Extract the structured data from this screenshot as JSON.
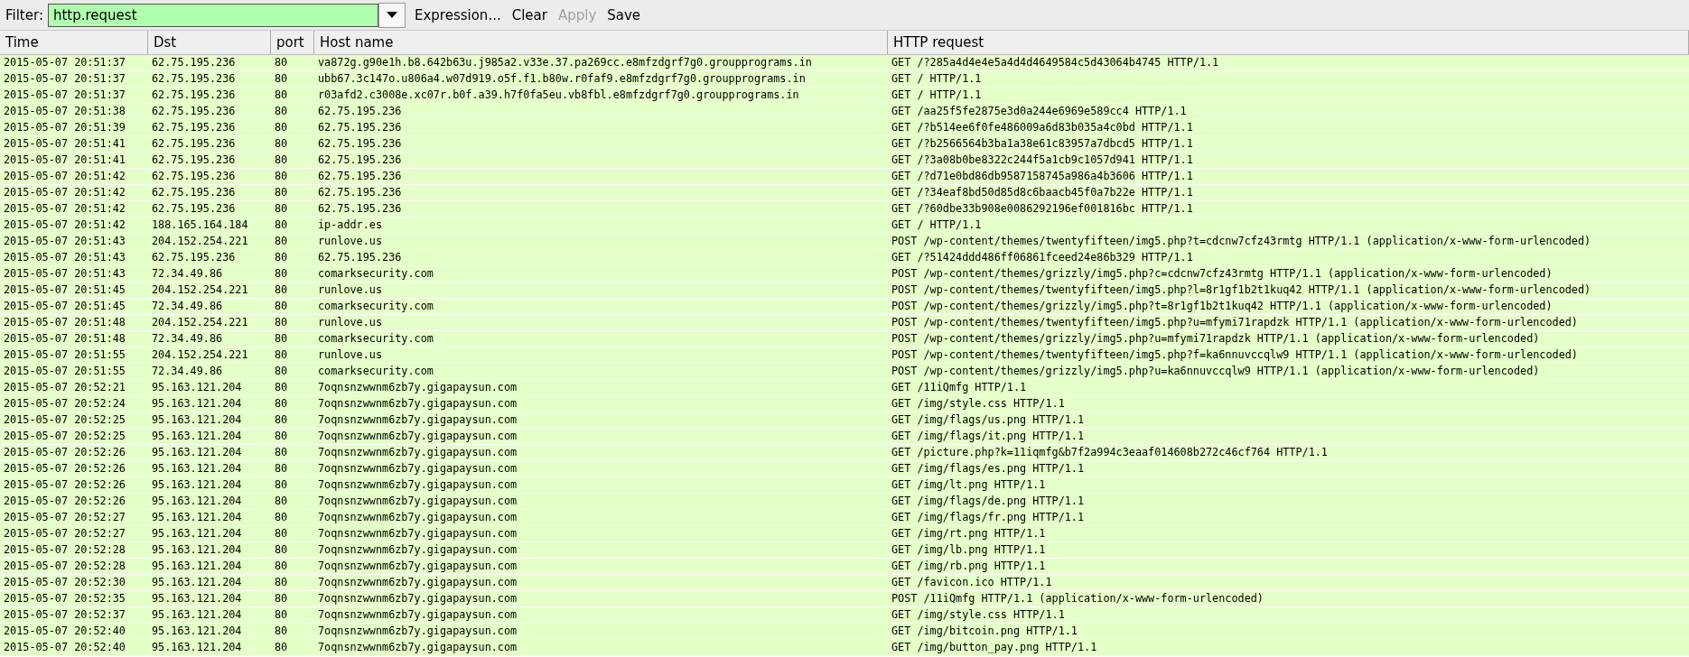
{
  "toolbar": {
    "filter_label": "Filter:",
    "filter_value": "http.request",
    "buttons": [
      {
        "label": "Expression...",
        "disabled": false
      },
      {
        "label": "Clear",
        "disabled": false
      },
      {
        "label": "Apply",
        "disabled": true
      },
      {
        "label": "Save",
        "disabled": false
      }
    ]
  },
  "table": {
    "columns": [
      "Time",
      "Dst",
      "port",
      "Host name",
      "HTTP request"
    ],
    "rows": [
      [
        "2015-05-07 20:51:37",
        "62.75.195.236",
        "80",
        "va872g.g90e1h.b8.642b63u.j985a2.v33e.37.pa269cc.e8mfzdgrf7g0.groupprograms.in",
        "GET /?285a4d4e4e5a4d4d4649584c5d43064b4745 HTTP/1.1"
      ],
      [
        "2015-05-07 20:51:37",
        "62.75.195.236",
        "80",
        "ubb67.3c147o.u806a4.w07d919.o5f.f1.b80w.r0faf9.e8mfzdgrf7g0.groupprograms.in",
        "GET / HTTP/1.1"
      ],
      [
        "2015-05-07 20:51:37",
        "62.75.195.236",
        "80",
        "r03afd2.c3008e.xc07r.b0f.a39.h7f0fa5eu.vb8fbl.e8mfzdgrf7g0.groupprograms.in",
        "GET / HTTP/1.1"
      ],
      [
        "2015-05-07 20:51:38",
        "62.75.195.236",
        "80",
        "62.75.195.236",
        "GET /aa25f5fe2875e3d0a244e6969e589cc4 HTTP/1.1"
      ],
      [
        "2015-05-07 20:51:39",
        "62.75.195.236",
        "80",
        "62.75.195.236",
        "GET /?b514ee6f0fe486009a6d83b035a4c0bd HTTP/1.1"
      ],
      [
        "2015-05-07 20:51:41",
        "62.75.195.236",
        "80",
        "62.75.195.236",
        "GET /?b2566564b3ba1a38e61c83957a7dbcd5 HTTP/1.1"
      ],
      [
        "2015-05-07 20:51:41",
        "62.75.195.236",
        "80",
        "62.75.195.236",
        "GET /?3a08b0be8322c244f5a1cb9c1057d941 HTTP/1.1"
      ],
      [
        "2015-05-07 20:51:42",
        "62.75.195.236",
        "80",
        "62.75.195.236",
        "GET /?d71e0bd86db9587158745a986a4b3606 HTTP/1.1"
      ],
      [
        "2015-05-07 20:51:42",
        "62.75.195.236",
        "80",
        "62.75.195.236",
        "GET /?34eaf8bd50d85d8c6baacb45f0a7b22e HTTP/1.1"
      ],
      [
        "2015-05-07 20:51:42",
        "62.75.195.236",
        "80",
        "62.75.195.236",
        "GET /?60dbe33b908e0086292196ef001816bc HTTP/1.1"
      ],
      [
        "2015-05-07 20:51:42",
        "188.165.164.184",
        "80",
        "ip-addr.es",
        "GET / HTTP/1.1"
      ],
      [
        "2015-05-07 20:51:43",
        "204.152.254.221",
        "80",
        "runlove.us",
        "POST /wp-content/themes/twentyfifteen/img5.php?t=cdcnw7cfz43rmtg HTTP/1.1  (application/x-www-form-urlencoded)"
      ],
      [
        "2015-05-07 20:51:43",
        "62.75.195.236",
        "80",
        "62.75.195.236",
        "GET /?51424ddd486ff06861fceed24e86b329 HTTP/1.1"
      ],
      [
        "2015-05-07 20:51:43",
        "72.34.49.86",
        "80",
        "comarksecurity.com",
        "POST /wp-content/themes/grizzly/img5.php?c=cdcnw7cfz43rmtg HTTP/1.1  (application/x-www-form-urlencoded)"
      ],
      [
        "2015-05-07 20:51:45",
        "204.152.254.221",
        "80",
        "runlove.us",
        "POST /wp-content/themes/twentyfifteen/img5.php?l=8r1gf1b2t1kuq42 HTTP/1.1  (application/x-www-form-urlencoded)"
      ],
      [
        "2015-05-07 20:51:45",
        "72.34.49.86",
        "80",
        "comarksecurity.com",
        "POST /wp-content/themes/grizzly/img5.php?t=8r1gf1b2t1kuq42 HTTP/1.1  (application/x-www-form-urlencoded)"
      ],
      [
        "2015-05-07 20:51:48",
        "204.152.254.221",
        "80",
        "runlove.us",
        "POST /wp-content/themes/twentyfifteen/img5.php?u=mfymi71rapdzk HTTP/1.1  (application/x-www-form-urlencoded)"
      ],
      [
        "2015-05-07 20:51:48",
        "72.34.49.86",
        "80",
        "comarksecurity.com",
        "POST /wp-content/themes/grizzly/img5.php?u=mfymi71rapdzk HTTP/1.1  (application/x-www-form-urlencoded)"
      ],
      [
        "2015-05-07 20:51:55",
        "204.152.254.221",
        "80",
        "runlove.us",
        "POST /wp-content/themes/twentyfifteen/img5.php?f=ka6nnuvccqlw9 HTTP/1.1  (application/x-www-form-urlencoded)"
      ],
      [
        "2015-05-07 20:51:55",
        "72.34.49.86",
        "80",
        "comarksecurity.com",
        "POST /wp-content/themes/grizzly/img5.php?u=ka6nnuvccqlw9 HTTP/1.1  (application/x-www-form-urlencoded)"
      ],
      [
        "2015-05-07 20:52:21",
        "95.163.121.204",
        "80",
        "7oqnsnzwwnm6zb7y.gigapaysun.com",
        "GET /11iQmfg HTTP/1.1"
      ],
      [
        "2015-05-07 20:52:24",
        "95.163.121.204",
        "80",
        "7oqnsnzwwnm6zb7y.gigapaysun.com",
        "GET /img/style.css HTTP/1.1"
      ],
      [
        "2015-05-07 20:52:25",
        "95.163.121.204",
        "80",
        "7oqnsnzwwnm6zb7y.gigapaysun.com",
        "GET /img/flags/us.png HTTP/1.1"
      ],
      [
        "2015-05-07 20:52:25",
        "95.163.121.204",
        "80",
        "7oqnsnzwwnm6zb7y.gigapaysun.com",
        "GET /img/flags/it.png HTTP/1.1"
      ],
      [
        "2015-05-07 20:52:26",
        "95.163.121.204",
        "80",
        "7oqnsnzwwnm6zb7y.gigapaysun.com",
        "GET /picture.php?k=11iqmfg&b7f2a994c3eaaf014608b272c46cf764 HTTP/1.1"
      ],
      [
        "2015-05-07 20:52:26",
        "95.163.121.204",
        "80",
        "7oqnsnzwwnm6zb7y.gigapaysun.com",
        "GET /img/flags/es.png HTTP/1.1"
      ],
      [
        "2015-05-07 20:52:26",
        "95.163.121.204",
        "80",
        "7oqnsnzwwnm6zb7y.gigapaysun.com",
        "GET /img/lt.png HTTP/1.1"
      ],
      [
        "2015-05-07 20:52:26",
        "95.163.121.204",
        "80",
        "7oqnsnzwwnm6zb7y.gigapaysun.com",
        "GET /img/flags/de.png HTTP/1.1"
      ],
      [
        "2015-05-07 20:52:27",
        "95.163.121.204",
        "80",
        "7oqnsnzwwnm6zb7y.gigapaysun.com",
        "GET /img/flags/fr.png HTTP/1.1"
      ],
      [
        "2015-05-07 20:52:27",
        "95.163.121.204",
        "80",
        "7oqnsnzwwnm6zb7y.gigapaysun.com",
        "GET /img/rt.png HTTP/1.1"
      ],
      [
        "2015-05-07 20:52:28",
        "95.163.121.204",
        "80",
        "7oqnsnzwwnm6zb7y.gigapaysun.com",
        "GET /img/lb.png HTTP/1.1"
      ],
      [
        "2015-05-07 20:52:28",
        "95.163.121.204",
        "80",
        "7oqnsnzwwnm6zb7y.gigapaysun.com",
        "GET /img/rb.png HTTP/1.1"
      ],
      [
        "2015-05-07 20:52:30",
        "95.163.121.204",
        "80",
        "7oqnsnzwwnm6zb7y.gigapaysun.com",
        "GET /favicon.ico HTTP/1.1"
      ],
      [
        "2015-05-07 20:52:35",
        "95.163.121.204",
        "80",
        "7oqnsnzwwnm6zb7y.gigapaysun.com",
        "POST /11iQmfg HTTP/1.1  (application/x-www-form-urlencoded)"
      ],
      [
        "2015-05-07 20:52:37",
        "95.163.121.204",
        "80",
        "7oqnsnzwwnm6zb7y.gigapaysun.com",
        "GET /img/style.css HTTP/1.1"
      ],
      [
        "2015-05-07 20:52:40",
        "95.163.121.204",
        "80",
        "7oqnsnzwwnm6zb7y.gigapaysun.com",
        "GET /img/bitcoin.png HTTP/1.1"
      ],
      [
        "2015-05-07 20:52:40",
        "95.163.121.204",
        "80",
        "7oqnsnzwwnm6zb7y.gigapaysun.com",
        "GET /img/button_pay.png HTTP/1.1"
      ]
    ]
  }
}
